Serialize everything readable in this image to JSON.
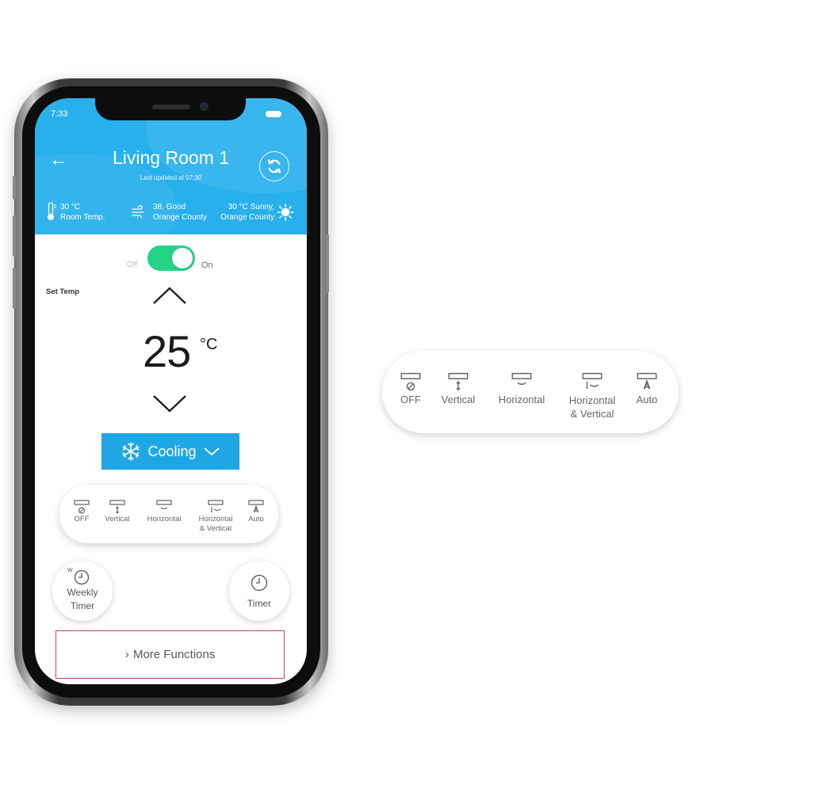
{
  "status_bar": {
    "time": "7:33"
  },
  "header": {
    "title": "Living Room 1",
    "last_updated": "Last updated at 07:30",
    "room_temp_value": "30 °C",
    "room_temp_label": "Room Temp.",
    "air_quality_value": "38, Good",
    "air_quality_location": "Orange County",
    "weather_value": "30 °C Sunny,",
    "weather_location": "Orange County"
  },
  "power": {
    "off_label": "Off",
    "on_label": "On",
    "state": "on"
  },
  "temperature": {
    "label": "Set Temp",
    "value": "25",
    "unit": "°C"
  },
  "mode": {
    "selected": "Cooling"
  },
  "swing_options": [
    {
      "label": "OFF",
      "label2": ""
    },
    {
      "label": "Vertical",
      "label2": ""
    },
    {
      "label": "Horizontal",
      "label2": ""
    },
    {
      "label": "Horizontal",
      "label2": "& Vertical"
    },
    {
      "label": "Auto",
      "label2": ""
    }
  ],
  "timers": {
    "weekly_line1": "Weekly",
    "weekly_line2": "Timer",
    "weekly_badge": "W",
    "timer_label": "Timer"
  },
  "more_functions": {
    "label": "More Functions"
  },
  "colors": {
    "header": "#28b0ec",
    "toggle_on": "#23d487",
    "mode_bg": "#1ea7e4",
    "more_border": "#cc3d6b"
  }
}
